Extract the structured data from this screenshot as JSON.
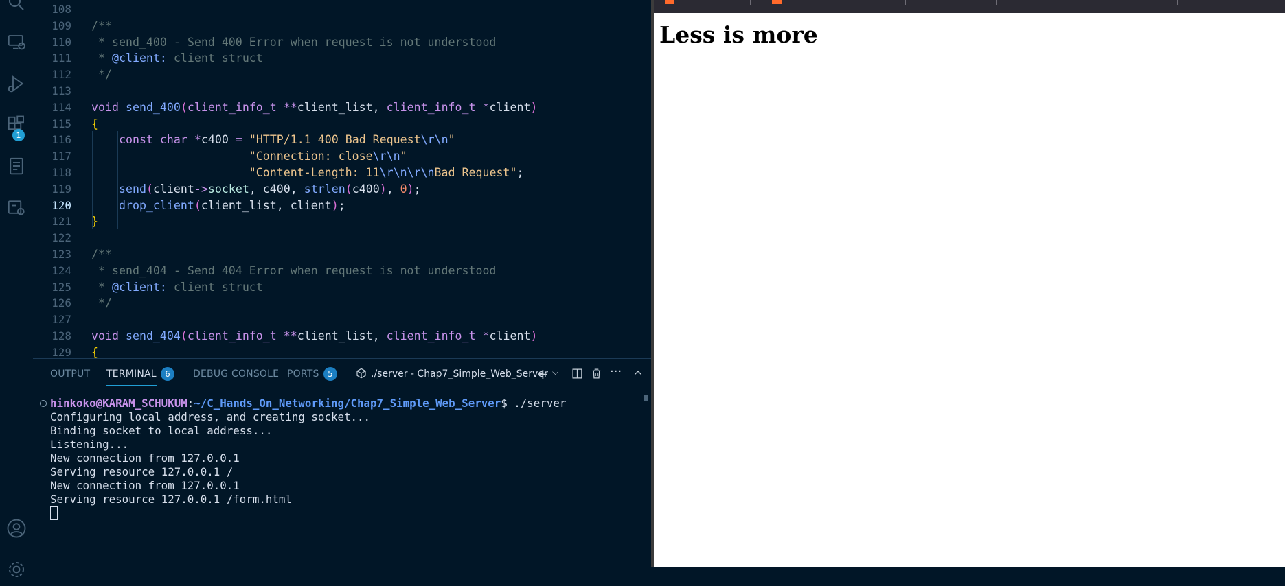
{
  "activity_bar": {
    "items": [
      {
        "name": "search-icon"
      },
      {
        "name": "remote-explorer-icon"
      },
      {
        "name": "run-debug-icon"
      },
      {
        "name": "extensions-icon",
        "badge": "1"
      },
      {
        "name": "outline-icon"
      },
      {
        "name": "docker-icon"
      },
      {
        "name": "account-icon"
      },
      {
        "name": "settings-gear-icon"
      }
    ]
  },
  "editor": {
    "active_line": 120,
    "lines": [
      {
        "n": 108,
        "tokens": []
      },
      {
        "n": 109,
        "tokens": [
          {
            "t": "/**",
            "c": "c-com"
          }
        ]
      },
      {
        "n": 110,
        "tokens": [
          {
            "t": " * send_400 - Send 400 Error when request is not understood",
            "c": "c-com"
          }
        ]
      },
      {
        "n": 111,
        "tokens": [
          {
            "t": " * ",
            "c": "c-com"
          },
          {
            "t": "@client:",
            "c": "c-tag"
          },
          {
            "t": " client struct",
            "c": "c-com"
          }
        ]
      },
      {
        "n": 112,
        "tokens": [
          {
            "t": " */",
            "c": "c-com"
          }
        ]
      },
      {
        "n": 113,
        "tokens": []
      },
      {
        "n": 114,
        "tokens": [
          {
            "t": "void",
            "c": "c-kw"
          },
          {
            "t": " "
          },
          {
            "t": "send_400",
            "c": "c-fn"
          },
          {
            "t": "(",
            "c": "c-paren"
          },
          {
            "t": "client_info_t",
            "c": "c-type"
          },
          {
            "t": " "
          },
          {
            "t": "**",
            "c": "c-op"
          },
          {
            "t": "client_list, "
          },
          {
            "t": "client_info_t",
            "c": "c-type"
          },
          {
            "t": " "
          },
          {
            "t": "*",
            "c": "c-op"
          },
          {
            "t": "client"
          },
          {
            "t": ")",
            "c": "c-paren"
          }
        ]
      },
      {
        "n": 115,
        "tokens": [
          {
            "t": "{",
            "c": "c-brace"
          }
        ]
      },
      {
        "n": 116,
        "tokens": [
          {
            "t": "    "
          },
          {
            "t": "const",
            "c": "c-kw"
          },
          {
            "t": " "
          },
          {
            "t": "char",
            "c": "c-kw"
          },
          {
            "t": " "
          },
          {
            "t": "*",
            "c": "c-op"
          },
          {
            "t": "c400 "
          },
          {
            "t": "=",
            "c": "c-op"
          },
          {
            "t": " "
          },
          {
            "t": "\"HTTP/1.1 400 Bad Request",
            "c": "c-str"
          },
          {
            "t": "\\r\\n",
            "c": "c-esc"
          },
          {
            "t": "\"",
            "c": "c-str"
          }
        ]
      },
      {
        "n": 117,
        "tokens": [
          {
            "t": "                       "
          },
          {
            "t": "\"Connection: close",
            "c": "c-str"
          },
          {
            "t": "\\r\\n",
            "c": "c-esc"
          },
          {
            "t": "\"",
            "c": "c-str"
          }
        ]
      },
      {
        "n": 118,
        "tokens": [
          {
            "t": "                       "
          },
          {
            "t": "\"Content-Length: 11",
            "c": "c-str"
          },
          {
            "t": "\\r\\n\\r\\n",
            "c": "c-esc"
          },
          {
            "t": "Bad Request\"",
            "c": "c-str"
          },
          {
            "t": ";"
          }
        ]
      },
      {
        "n": 119,
        "tokens": [
          {
            "t": "    "
          },
          {
            "t": "send",
            "c": "c-fn"
          },
          {
            "t": "(",
            "c": "c-paren"
          },
          {
            "t": "client"
          },
          {
            "t": "->",
            "c": "c-op"
          },
          {
            "t": "socket",
            "c": "c-prop"
          },
          {
            "t": ", c400, "
          },
          {
            "t": "strlen",
            "c": "c-fn"
          },
          {
            "t": "(",
            "c": "c-paren"
          },
          {
            "t": "c400"
          },
          {
            "t": ")",
            "c": "c-paren"
          },
          {
            "t": ", "
          },
          {
            "t": "0",
            "c": "c-num"
          },
          {
            "t": ")",
            "c": "c-paren"
          },
          {
            "t": ";"
          }
        ]
      },
      {
        "n": 120,
        "tokens": [
          {
            "t": "    "
          },
          {
            "t": "drop_client",
            "c": "c-fn"
          },
          {
            "t": "(",
            "c": "c-paren"
          },
          {
            "t": "client_list, client"
          },
          {
            "t": ")",
            "c": "c-paren"
          },
          {
            "t": ";"
          }
        ]
      },
      {
        "n": 121,
        "tokens": [
          {
            "t": "}",
            "c": "c-brace"
          }
        ]
      },
      {
        "n": 122,
        "tokens": []
      },
      {
        "n": 123,
        "tokens": [
          {
            "t": "/**",
            "c": "c-com"
          }
        ]
      },
      {
        "n": 124,
        "tokens": [
          {
            "t": " * send_404 - Send 404 Error when request is not understood",
            "c": "c-com"
          }
        ]
      },
      {
        "n": 125,
        "tokens": [
          {
            "t": " * ",
            "c": "c-com"
          },
          {
            "t": "@client:",
            "c": "c-tag"
          },
          {
            "t": " client struct",
            "c": "c-com"
          }
        ]
      },
      {
        "n": 126,
        "tokens": [
          {
            "t": " */",
            "c": "c-com"
          }
        ]
      },
      {
        "n": 127,
        "tokens": []
      },
      {
        "n": 128,
        "tokens": [
          {
            "t": "void",
            "c": "c-kw"
          },
          {
            "t": " "
          },
          {
            "t": "send_404",
            "c": "c-fn"
          },
          {
            "t": "(",
            "c": "c-paren"
          },
          {
            "t": "client_info_t",
            "c": "c-type"
          },
          {
            "t": " "
          },
          {
            "t": "**",
            "c": "c-op"
          },
          {
            "t": "client_list, "
          },
          {
            "t": "client_info_t",
            "c": "c-type"
          },
          {
            "t": " "
          },
          {
            "t": "*",
            "c": "c-op"
          },
          {
            "t": "client"
          },
          {
            "t": ")",
            "c": "c-paren"
          }
        ]
      },
      {
        "n": 129,
        "tokens": [
          {
            "t": "{",
            "c": "c-brace"
          }
        ]
      }
    ]
  },
  "panel": {
    "tabs": {
      "output": "OUTPUT",
      "terminal": "TERMINAL",
      "terminal_badge": "6",
      "debug_console": "DEBUG CONSOLE",
      "ports": "PORTS",
      "ports_badge": "5"
    },
    "terminal_name": "./server - Chap7_Simple_Web_Server",
    "prompt": {
      "user": "hinkoko@KARAM_SCHUKUM",
      "sep": ":",
      "path": "~/C_Hands_On_Networking/Chap7_Simple_Web_Server",
      "command": "$ ./server"
    },
    "output_lines": [
      "Configuring local address, and creating socket...",
      "Binding socket to local address...",
      "Listening...",
      "New connection from 127.0.0.1",
      "Serving resource 127.0.0.1 /",
      "New connection from 127.0.0.1",
      "Serving resource 127.0.0.1 /form.html"
    ]
  },
  "browser": {
    "heading": "Less is more"
  },
  "colors": {
    "editor_bg": "#011627",
    "accent": "#219fd5",
    "browser_bar": "#2b2a33",
    "browser_tab_accent": "#ff6a2b"
  }
}
